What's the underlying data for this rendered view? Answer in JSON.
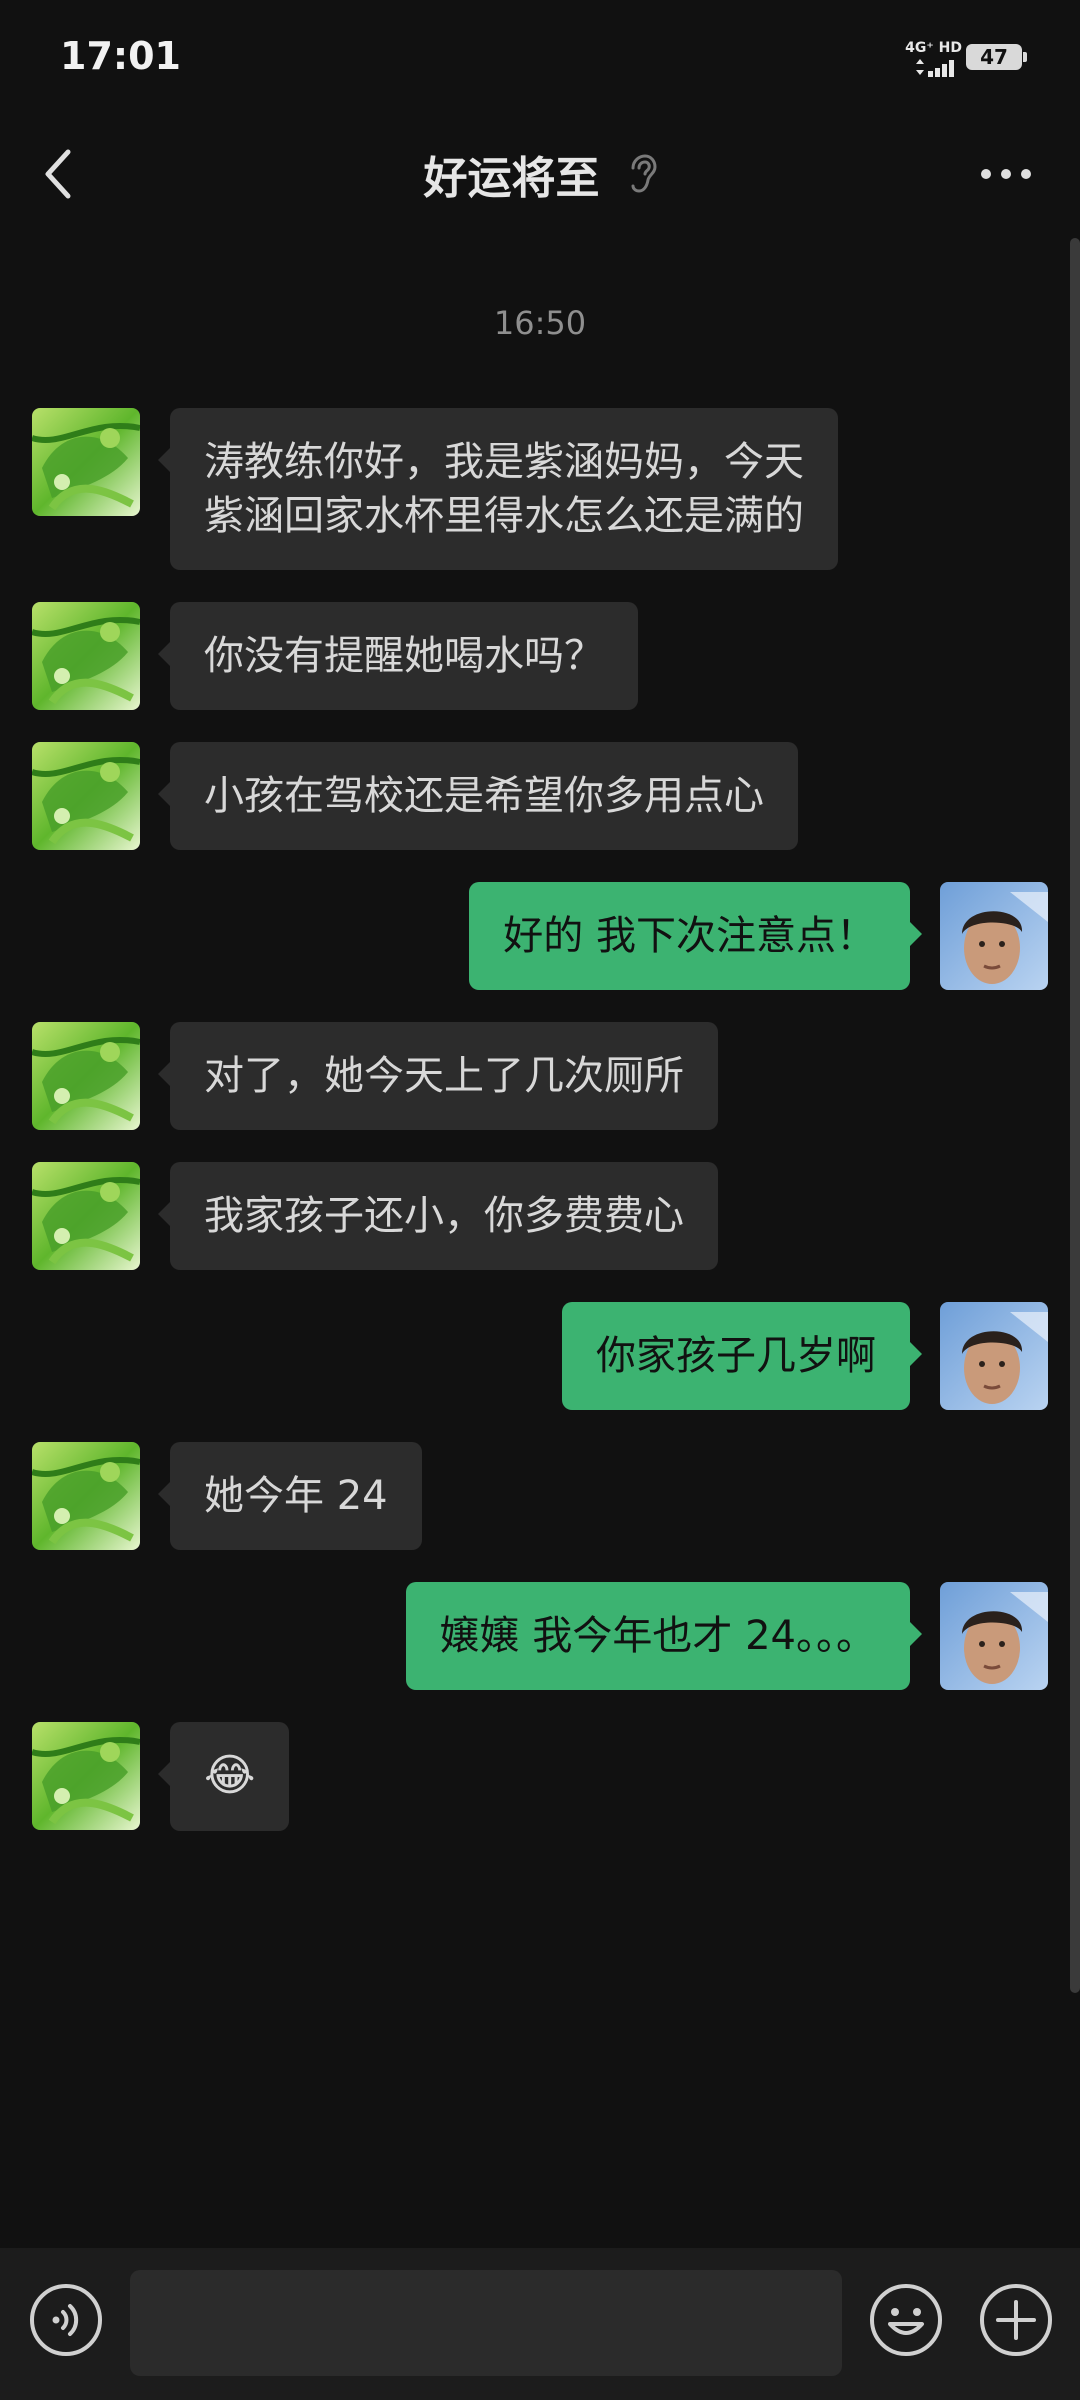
{
  "status_bar": {
    "time": "17:01",
    "network": "4G⁺ HD",
    "battery": "47"
  },
  "header": {
    "title": "好运将至"
  },
  "chat": {
    "timestamp": "16:50",
    "messages": [
      {
        "side": "in",
        "lines": [
          "涛教练你好，我是紫涵妈妈，今天",
          "紫涵回家水杯里得水怎么还是满的"
        ]
      },
      {
        "side": "in",
        "text": "你没有提醒她喝水吗？"
      },
      {
        "side": "in",
        "text": "小孩在驾校还是希望你多用点心"
      },
      {
        "side": "out",
        "text": "好的  我下次注意点！"
      },
      {
        "side": "in",
        "text": "对了，她今天上了几次厕所"
      },
      {
        "side": "in",
        "text": "我家孩子还小，你多费费心"
      },
      {
        "side": "out",
        "text": "你家孩子几岁啊"
      },
      {
        "side": "in",
        "text": "她今年 24"
      },
      {
        "side": "out",
        "text": "嬢嬢  我今年也才 24。。。"
      },
      {
        "side": "in",
        "text": "😂",
        "emoji": true
      }
    ]
  },
  "input": {
    "value": "",
    "placeholder": ""
  },
  "icons": {
    "back": "chevron-left-icon",
    "ear": "ear-icon",
    "more": "more-dots-icon",
    "voice": "voice-icon",
    "emoji": "emoji-icon",
    "plus": "plus-icon"
  },
  "colors": {
    "background": "#111111",
    "incoming_bubble": "#2c2c2c",
    "outgoing_bubble": "#3cb371",
    "input_bar": "#1c1c1c"
  }
}
